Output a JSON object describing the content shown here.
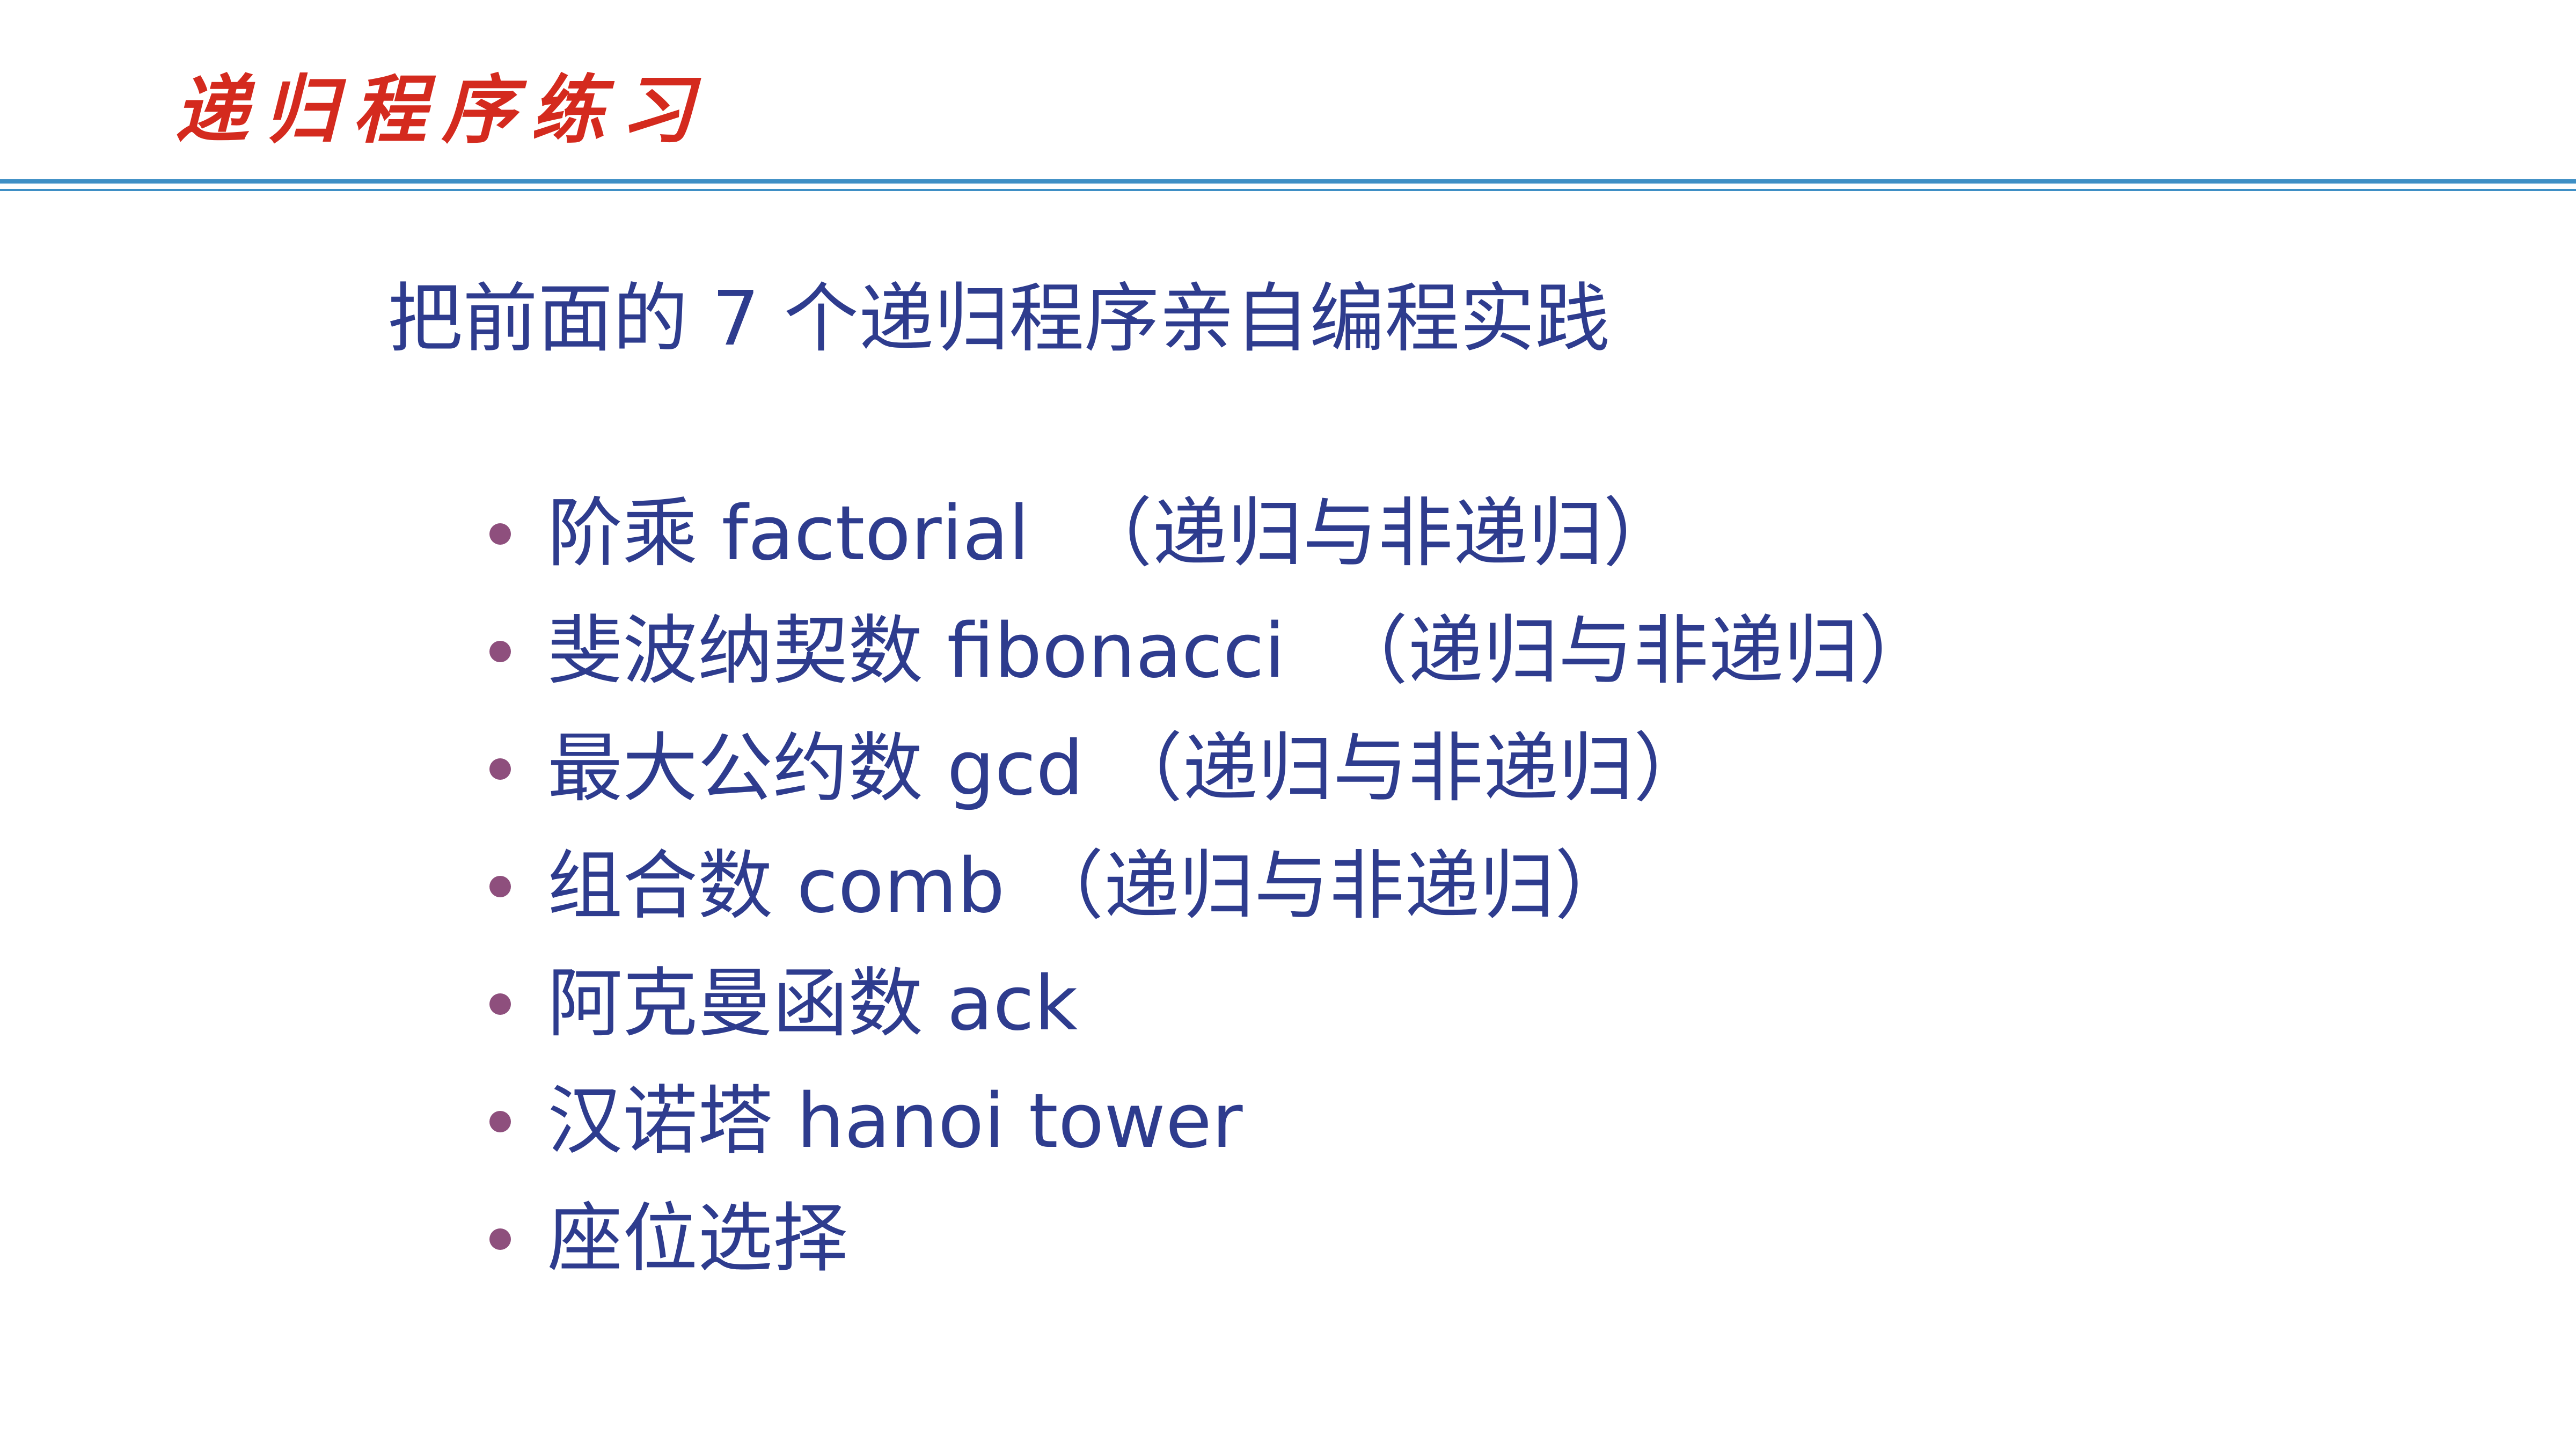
{
  "slide": {
    "title": "递归程序练习",
    "subtitle": "把前面的 7 个递归程序亲自编程实践",
    "items": [
      "阶乘 factorial  （递归与非递归）",
      "斐波纳契数 fibonacci  （递归与非递归）",
      "最大公约数 gcd （递归与非递归）",
      "组合数 comb （递归与非递归）",
      "阿克曼函数 ack",
      "汉诺塔 hanoi tower",
      "座位选择"
    ]
  },
  "colors": {
    "title": "#d42a1e",
    "body_text": "#2e3c8e",
    "bullet": "#8e4f7d",
    "rule": "#3f8fc5",
    "background": "#ffffff"
  }
}
